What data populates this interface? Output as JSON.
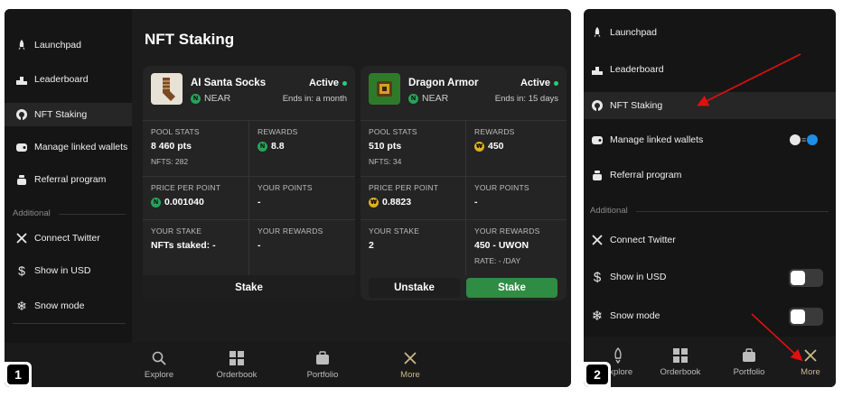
{
  "screen1": {
    "badge": "1",
    "sidebar": {
      "items": [
        {
          "label": "Launchpad",
          "icon": "rocket-icon"
        },
        {
          "label": "Leaderboard",
          "icon": "podium-icon"
        },
        {
          "label": "NFT Staking",
          "icon": "staking-icon",
          "active": true
        },
        {
          "label": "Manage linked wallets",
          "icon": "wallet-icon"
        },
        {
          "label": "Referral program",
          "icon": "gift-icon"
        }
      ],
      "additional_label": "Additional",
      "additional_items": [
        {
          "label": "Connect Twitter",
          "icon": "x-twitter-icon"
        },
        {
          "label": "Show in USD",
          "icon": "dollar-icon"
        },
        {
          "label": "Snow mode",
          "icon": "snowflake-icon"
        }
      ]
    },
    "title": "NFT Staking",
    "cards": [
      {
        "name": "AI Santa Socks",
        "chain": "NEAR",
        "status": "Active",
        "ends": "Ends in: a month",
        "pool_stats_label": "POOL STATS",
        "pool_stats_value": "8 460 pts",
        "nfts": "NFTS: 282",
        "rewards_label": "REWARDS",
        "rewards_value": "8.8",
        "price_label": "PRICE PER POINT",
        "price_value": "0.001040",
        "your_points_label": "YOUR POINTS",
        "your_points_value": "-",
        "your_stake_label": "YOUR STAKE",
        "your_stake_value": "NFTs staked: -",
        "your_rewards_label": "YOUR REWARDS",
        "your_rewards_value": "-",
        "buttons": [
          "Stake"
        ]
      },
      {
        "name": "Dragon Armor",
        "chain": "NEAR",
        "status": "Active",
        "ends": "Ends in: 15 days",
        "pool_stats_label": "POOL STATS",
        "pool_stats_value": "510 pts",
        "nfts": "NFTS: 34",
        "rewards_label": "REWARDS",
        "rewards_value": "450",
        "price_label": "PRICE PER POINT",
        "price_value": "0.8823",
        "your_points_label": "YOUR POINTS",
        "your_points_value": "-",
        "your_stake_label": "YOUR STAKE",
        "your_stake_value": "2",
        "your_rewards_label": "YOUR REWARDS",
        "your_rewards_value": "450 - UWON",
        "rate": "RATE: - /DAY",
        "buttons": [
          "Unstake",
          "Stake"
        ]
      }
    ],
    "tabs": [
      {
        "label": "Explore",
        "icon": "search-icon"
      },
      {
        "label": "Orderbook",
        "icon": "orderbook-icon"
      },
      {
        "label": "Portfolio",
        "icon": "briefcase-icon"
      },
      {
        "label": "More",
        "icon": "close-icon",
        "active": true
      }
    ]
  },
  "screen2": {
    "badge": "2",
    "sidebar": {
      "items": [
        {
          "label": "Launchpad",
          "icon": "rocket-icon"
        },
        {
          "label": "Leaderboard",
          "icon": "podium-icon"
        },
        {
          "label": "NFT Staking",
          "icon": "staking-icon",
          "active": true
        },
        {
          "label": "Manage linked wallets",
          "icon": "wallet-icon"
        },
        {
          "label": "Referral program",
          "icon": "gift-icon"
        }
      ],
      "additional_label": "Additional",
      "additional_items": [
        {
          "label": "Connect Twitter",
          "icon": "x-twitter-icon"
        },
        {
          "label": "Show in USD",
          "icon": "dollar-icon",
          "toggle": false
        },
        {
          "label": "Snow mode",
          "icon": "snowflake-icon",
          "toggle": false
        }
      ]
    },
    "tabs": [
      {
        "label": "Explore",
        "icon": "rocket-icon"
      },
      {
        "label": "Orderbook",
        "icon": "orderbook-icon"
      },
      {
        "label": "Portfolio",
        "icon": "briefcase-icon"
      },
      {
        "label": "More",
        "icon": "close-icon",
        "active": true
      }
    ]
  },
  "colors": {
    "accent_green": "#2e8c43",
    "status_green": "#2ecc71",
    "annotation_red": "#e01010",
    "more_tab": "#c9b98a"
  }
}
